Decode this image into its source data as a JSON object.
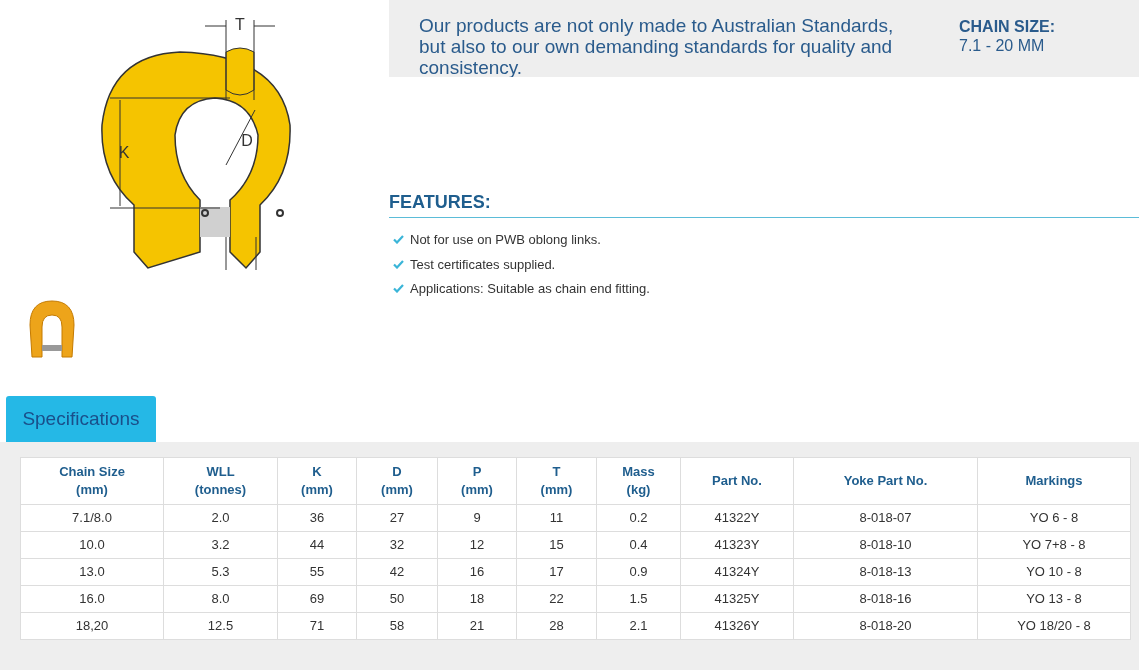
{
  "diagram": {
    "labels": {
      "t": "T",
      "k": "K",
      "d": "D"
    }
  },
  "intro": "Our products are not only made to Australian Standards, but also to our own demanding standards for quality and consistency.",
  "chain_size": {
    "title": "CHAIN SIZE:",
    "value": "7.1 - 20 MM"
  },
  "features": {
    "title": "FEATURES:",
    "items": [
      "Not for use on PWB oblong links.",
      "Test certificates supplied.",
      "Applications: Suitable as chain end fitting."
    ]
  },
  "tabs": [
    {
      "label": "Specifications",
      "selected": true
    }
  ],
  "table": {
    "columns": [
      "Chain Size\n(mm)",
      "WLL\n(tonnes)",
      "K\n(mm)",
      "D\n(mm)",
      "P\n(mm)",
      "T\n(mm)",
      "Mass\n(kg)",
      "Part No.",
      "Yoke Part No.",
      "Markings"
    ],
    "rows": [
      [
        "7.1/8.0",
        "2.0",
        "36",
        "27",
        "9",
        "11",
        "0.2",
        "41322Y",
        "8-018-07",
        "YO 6 - 8"
      ],
      [
        "10.0",
        "3.2",
        "44",
        "32",
        "12",
        "15",
        "0.4",
        "41323Y",
        "8-018-10",
        "YO 7+8 - 8"
      ],
      [
        "13.0",
        "5.3",
        "55",
        "42",
        "16",
        "17",
        "0.9",
        "41324Y",
        "8-018-13",
        "YO 10 - 8"
      ],
      [
        "16.0",
        "8.0",
        "69",
        "50",
        "18",
        "22",
        "1.5",
        "41325Y",
        "8-018-16",
        "YO 13 - 8"
      ],
      [
        "18,20",
        "12.5",
        "71",
        "58",
        "21",
        "28",
        "2.1",
        "41326Y",
        "8-018-20",
        "YO 18/20 - 8"
      ]
    ]
  }
}
